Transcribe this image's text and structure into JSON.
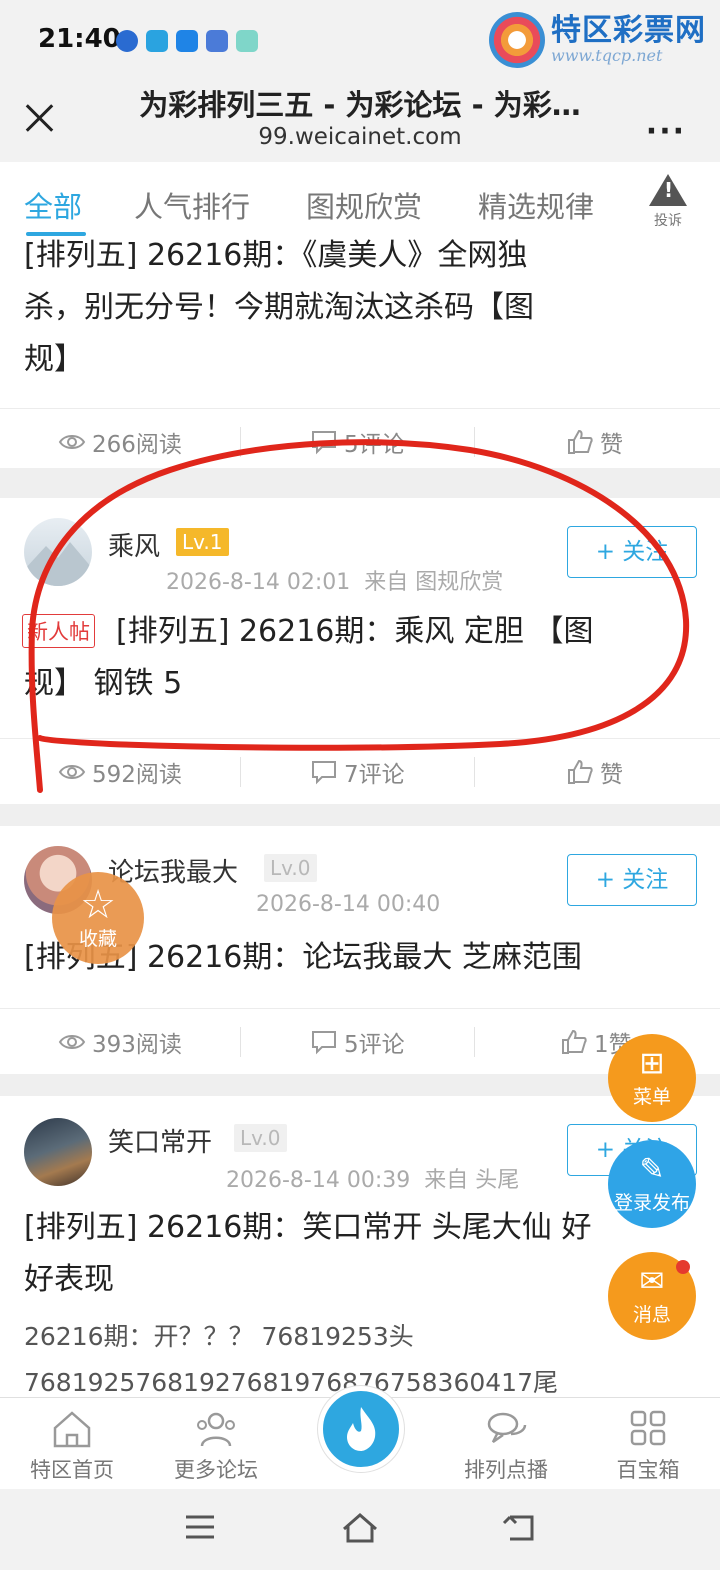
{
  "status_bar": {
    "time": "21:40"
  },
  "watermark": {
    "name": "特区彩票网",
    "url": "www.tqcp.net"
  },
  "browser": {
    "title": "为彩排列三五 - 为彩论坛 - 为彩…",
    "url": "99.weicainet.com"
  },
  "tabs": [
    {
      "label": "全部",
      "active": true
    },
    {
      "label": "人气排行"
    },
    {
      "label": "图规欣赏"
    },
    {
      "label": "精选规律"
    }
  ],
  "report_label": "投诉",
  "posts": [
    {
      "title_lines": [
        "[排列五] 26216期：《虞美人》全网独",
        "杀，别无分号！今期就淘汰这杀码【图",
        "规】"
      ],
      "reads": "266阅读",
      "comments": "5评论",
      "likes": "赞"
    },
    {
      "author": "乘风",
      "level": "Lv.1",
      "time": "2026-8-14 02:01",
      "source": "来自 图规欣赏",
      "follow": "+ 关注",
      "tag": "新人帖",
      "title_lines": [
        "[排列五] 26216期：乘风 定胆 【图",
        "规】 钢铁 5"
      ],
      "reads": "592阅读",
      "comments": "7评论",
      "likes": "赞"
    },
    {
      "author": "论坛我最大",
      "level": "Lv.0",
      "time": "2026-8-14 00:40",
      "follow": "+ 关注",
      "title_lines": [
        "[排列五] 26216期：论坛我最大 芝麻范围"
      ],
      "reads": "393阅读",
      "comments": "5评论",
      "likes": "1赞"
    },
    {
      "author": "笑口常开",
      "level": "Lv.0",
      "time": "2026-8-14 00:39",
      "source": "来自 头尾",
      "follow": "+ 关注",
      "title_lines": [
        "[排列五] 26216期：笑口常开 头尾大仙 好",
        "好表现"
      ],
      "body_lines": [
        "26216期：开？？？ 76819253头",
        "76819257681927681976876758360417尾"
      ]
    }
  ],
  "floating": {
    "favorite": "收藏",
    "menu": "菜单",
    "login_post": "登录发布",
    "messages": "消息"
  },
  "bottom_nav": [
    "特区首页",
    "更多论坛",
    "排列点播",
    "百宝箱"
  ],
  "colors": {
    "accent": "#2ea7e0",
    "orange": "#f59a1d",
    "annotation": "#e0261b"
  }
}
